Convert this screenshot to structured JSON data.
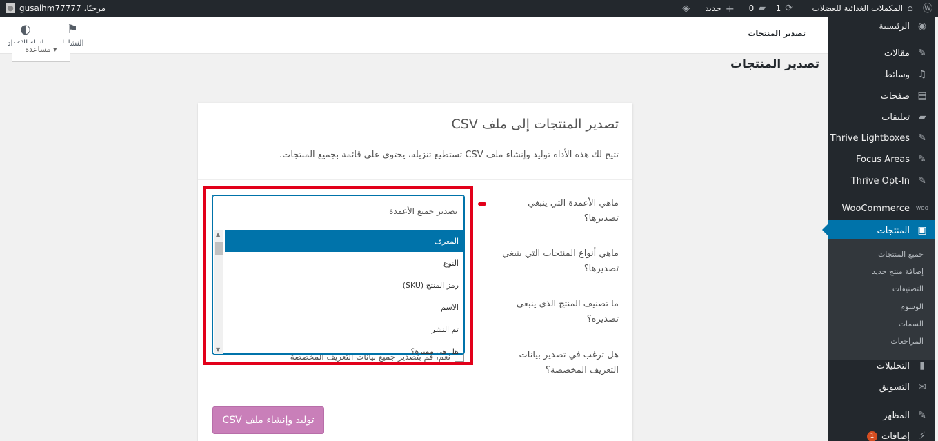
{
  "adminbar": {
    "site_name": "المكملات الغذائية للعضلات",
    "updates_count": "1",
    "comments_count": "0",
    "new_label": "جديد",
    "greeting": "مرحبًا، gusaihm77777"
  },
  "sidebar": {
    "items": [
      {
        "label": "الرئيسية",
        "icon": "dashboard-icon"
      },
      {
        "label": "مقالات",
        "icon": "pin-icon"
      },
      {
        "label": "وسائط",
        "icon": "media-icon"
      },
      {
        "label": "صفحات",
        "icon": "pages-icon"
      },
      {
        "label": "تعليقات",
        "icon": "comments-icon"
      },
      {
        "label": "Thrive Lightboxes",
        "icon": "pin-icon"
      },
      {
        "label": "Focus Areas",
        "icon": "pin-icon"
      },
      {
        "label": "Thrive Opt-In",
        "icon": "pin-icon"
      },
      {
        "label": "WooCommerce",
        "icon": "woo-icon"
      },
      {
        "label": "المنتجات",
        "icon": "archive-icon"
      },
      {
        "label": "التحليلات",
        "icon": "chart-icon"
      },
      {
        "label": "التسويق",
        "icon": "megaphone-icon"
      },
      {
        "label": "المظهر",
        "icon": "brush-icon"
      },
      {
        "label": "إضافات",
        "icon": "plugin-icon",
        "badge": "1"
      }
    ],
    "submenu": [
      "جميع المنتجات",
      "إضافة منتج جديد",
      "التصنيفات",
      "الوسوم",
      "السمات",
      "المراجعات"
    ]
  },
  "header": {
    "breadcrumb": "تصدير المنتجات",
    "activity_label": "النشاط",
    "finish_setup_label": "إنهاء الإعداد",
    "help_label": "مساعدة"
  },
  "page_title": "تصدير المنتجات",
  "card": {
    "title": "تصدير المنتجات إلى ملف CSV",
    "description": "تتيح لك هذه الأداة توليد وإنشاء ملف CSV تستطيع تنزيله، يحتوي على قائمة بجميع المنتجات.",
    "q_columns": "ماهي الأعمدة التي ينبغي تصديرها؟",
    "q_types": "ماهي أنواع المنتجات التي ينبغي تصديرها؟",
    "q_category": "ما تصنيف المنتج الذي ينبغي تصديره؟",
    "q_meta": "هل ترغب في تصدير بيانات التعريف المخصصة؟",
    "meta_checkbox_label": "نعم، قم بتصدير جميع بيانات التعريف المخصصة",
    "generate_button": "توليد وإنشاء ملف CSV"
  },
  "select": {
    "placeholder": "تصدير جميع الأعمدة",
    "options": [
      "المعرف",
      "النوع",
      "رمز المنتج (SKU)",
      "الاسم",
      "تم النشر",
      "هل هي مميزة؟"
    ],
    "selected_index": 0
  },
  "colors": {
    "adminbar": "#23282d",
    "active_menu": "#0073aa",
    "highlight": "#e2001a",
    "button": "#c97fb9"
  }
}
